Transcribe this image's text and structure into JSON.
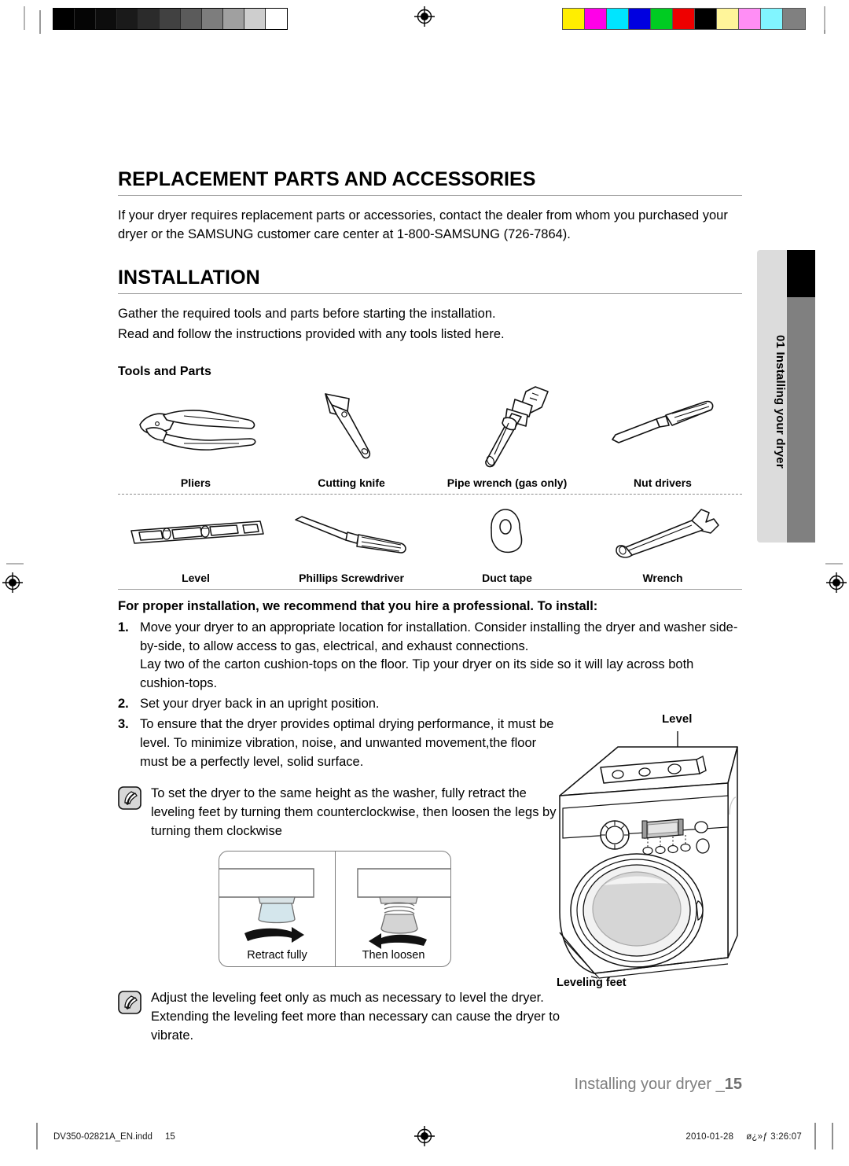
{
  "calibration": {
    "grayscale_patches": [
      "#000000",
      "#050505",
      "#0d0d0d",
      "#1a1a1a",
      "#2b2b2b",
      "#414141",
      "#5b5b5b",
      "#7d7d7d",
      "#a0a0a0",
      "#cecece",
      "#ffffff"
    ],
    "color_patches": [
      "#ffee00",
      "#ff00e8",
      "#00e5ff",
      "#0000e0",
      "#00cc22",
      "#ee0000",
      "#000000",
      "#fff59a",
      "#ff8ef5",
      "#81f5ff",
      "#808080"
    ]
  },
  "side_tab": {
    "label": "01 Installing your dryer",
    "dark_color": "#000000",
    "gray_color": "#808080",
    "bg_color": "#dcdcdc"
  },
  "sections": {
    "replacement": {
      "title": "REPLACEMENT PARTS AND ACCESSORIES",
      "body": "If your dryer requires replacement parts or accessories, contact the dealer from whom you purchased your dryer or the SAMSUNG customer care center at 1-800-SAMSUNG (726-7864)."
    },
    "installation": {
      "title": "INSTALLATION",
      "body_line1": "Gather the required tools and parts before starting the installation.",
      "body_line2": "Read and follow the instructions provided with any tools listed here."
    }
  },
  "tools": {
    "heading": "Tools and Parts",
    "row1": [
      {
        "label": "Pliers",
        "icon": "pliers-icon"
      },
      {
        "label": "Cutting knife",
        "icon": "cutting-knife-icon"
      },
      {
        "label": "Pipe wrench (gas only)",
        "icon": "pipe-wrench-icon"
      },
      {
        "label": "Nut drivers",
        "icon": "nut-driver-icon"
      }
    ],
    "row2": [
      {
        "label": "Level",
        "icon": "level-icon"
      },
      {
        "label": "Phillips Screwdriver",
        "icon": "phillips-screwdriver-icon"
      },
      {
        "label": "Duct tape",
        "icon": "duct-tape-icon"
      },
      {
        "label": "Wrench",
        "icon": "wrench-icon"
      }
    ]
  },
  "install": {
    "lead": "For proper installation, we recommend that you hire a professional. To install:",
    "steps": [
      {
        "num": "1.",
        "text": "Move your dryer to an appropriate location for installation. Consider installing the dryer and washer side-by-side, to allow access to gas, electrical, and exhaust connections.\nLay two of the carton cushion-tops on the floor. Tip your dryer on its side so it will lay across both cushion-tops."
      },
      {
        "num": "2.",
        "text": "Set your dryer back in an upright position."
      },
      {
        "num": "3.",
        "text": "To ensure that the dryer provides optimal drying performance, it must be level. To minimize vibration, noise, and unwanted movement,the floor must be a perfectly level, solid surface."
      }
    ],
    "note1": "To set the dryer to the same height as the washer, fully retract the leveling feet by turning them counterclockwise, then loosen the legs by turning them clockwise",
    "note2": "Adjust the leveling feet only as much as necessary to level the dryer. Extending the leveling feet more than necessary can cause the dryer to vibrate.",
    "diagram": {
      "left_caption": "Retract fully",
      "right_caption": "Then loosen"
    }
  },
  "dryer_illustration": {
    "level_label": "Level",
    "leveling_feet_label": "Leveling feet"
  },
  "footer": {
    "text": "Installing your dryer _",
    "page_number": "15"
  },
  "slug": {
    "filename": "DV350-02821A_EN.indd",
    "page": "15",
    "date": "2010-01-28",
    "time_marker": "ø¿»ƒ 3:26:07"
  }
}
